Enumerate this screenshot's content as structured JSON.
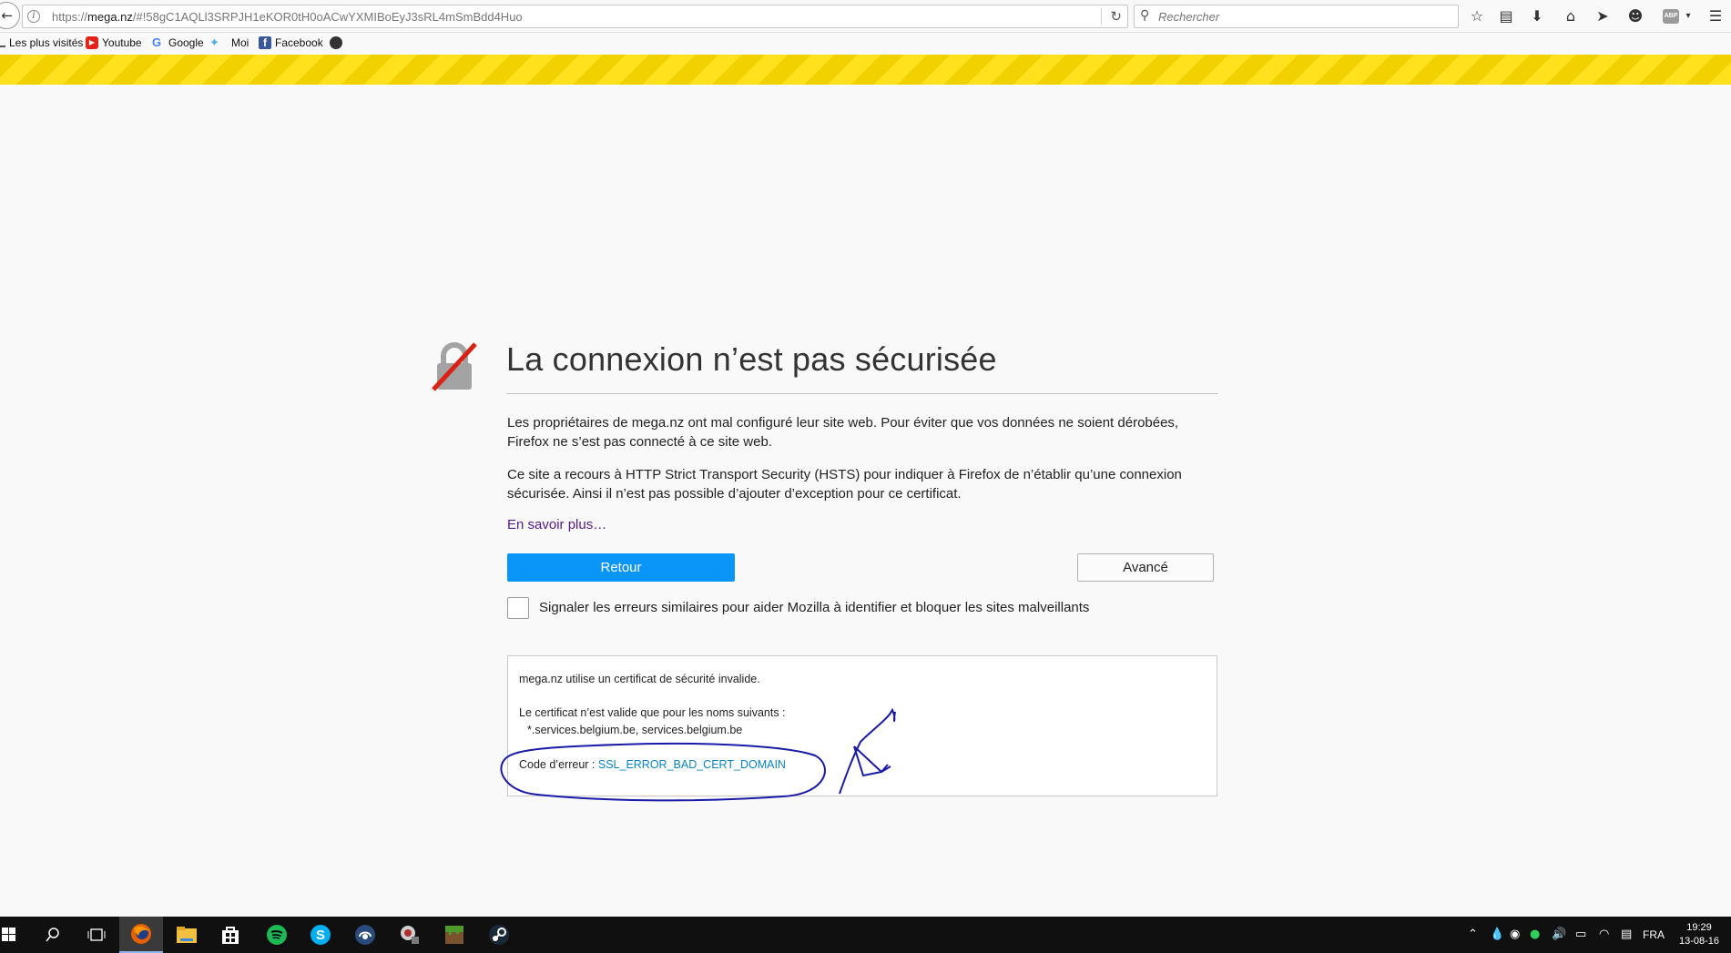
{
  "browser": {
    "url_prefix": "https://",
    "url_host": "mega.nz",
    "url_path": "/#!58gC1AQLl3SRPJH1eKOR0tH0oACwYXMIBoEyJ3sRL4mSmBdd4Huo",
    "search_placeholder": "Rechercher",
    "icons": [
      "back-icon",
      "info-icon",
      "reload-icon",
      "search-icon",
      "star-icon",
      "reading-list-icon",
      "download-icon",
      "home-icon",
      "send-icon",
      "smiley-icon",
      "adblock-icon",
      "menu-icon"
    ],
    "adblock_label": "ABP"
  },
  "bookmarks": [
    {
      "label": "Les plus visités",
      "icon": "none"
    },
    {
      "label": "Youtube",
      "icon": "youtube-icon"
    },
    {
      "label": "Google",
      "icon": "google-icon"
    },
    {
      "label": "Moi",
      "icon": "twitter-icon"
    },
    {
      "label": "Facebook",
      "icon": "facebook-icon"
    },
    {
      "label": "",
      "icon": "globe-icon"
    }
  ],
  "error": {
    "title": "La connexion n’est pas sécurisée",
    "paragraph1": "Les propriétaires de mega.nz ont mal configuré leur site web. Pour éviter que vos données ne soient dérobées, Firefox ne s’est pas connecté à ce site web.",
    "paragraph2": "Ce site a recours à HTTP Strict Transport Security (HSTS) pour indiquer à Firefox de n’établir qu’une connexion sécurisée. Ainsi il n’est pas possible d’ajouter d’exception pour ce certificat.",
    "learn_more": "En savoir plus…",
    "back_button": "Retour",
    "advanced_button": "Avancé",
    "report_label": "Signaler les erreurs similaires pour aider Mozilla à identifier et bloquer les sites malveillants",
    "report_checked": false
  },
  "details": {
    "line1": "mega.nz utilise un certificat de sécurité invalide.",
    "line2": "Le certificat n’est valide que pour les noms suivants :",
    "line3": "*.services.belgium.be, services.belgium.be",
    "code_label": "Code d’erreur : ",
    "code_value": "SSL_ERROR_BAD_CERT_DOMAIN"
  },
  "colors": {
    "stripe_a": "#f2d100",
    "stripe_b": "#ffe11e",
    "primary_button": "#0996f8",
    "link_visited": "#551a8b",
    "error_code": "#0a84c4",
    "ink": "#1a1aa8"
  },
  "taskbar": {
    "apps": [
      "windows-start-icon",
      "search-icon",
      "task-view-icon",
      "firefox-icon",
      "file-explorer-icon",
      "store-icon",
      "spotify-icon",
      "skype-icon",
      "teamspeak-icon",
      "mod-icon",
      "minecraft-icon",
      "steam-icon"
    ],
    "active_app": "firefox-icon",
    "tray_icons": [
      "chevron-up-icon",
      "droplet-icon",
      "steam-tray-icon",
      "green-circle-icon",
      "volume-icon",
      "battery-icon",
      "wifi-icon",
      "notifications-icon"
    ],
    "language": "FRA",
    "time": "19:29",
    "date": "13-08-16"
  }
}
